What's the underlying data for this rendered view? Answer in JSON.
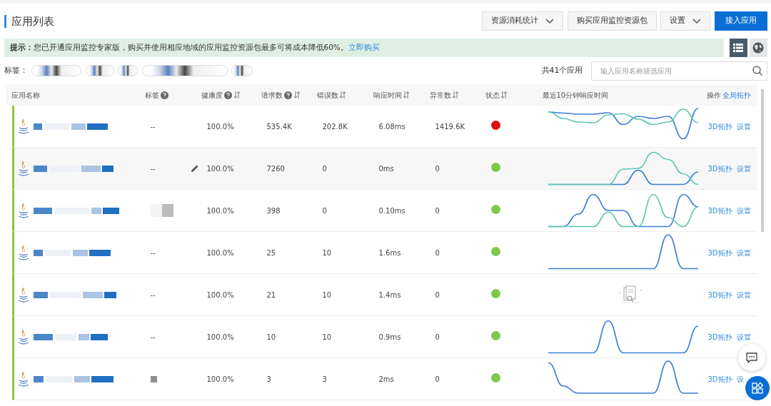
{
  "page": {
    "title": "应用列表"
  },
  "toolbar": [
    {
      "label": "资源消耗统计",
      "kind": "dropdown"
    },
    {
      "label": "购买应用监控资源包",
      "kind": "button"
    },
    {
      "label": "设置",
      "kind": "dropdown"
    },
    {
      "label": "接入应用",
      "kind": "primary"
    }
  ],
  "notice": {
    "prefix": "提示：",
    "text": "您已开通应用监控专家版，购买并使用相应地域的应用监控资源包最多可将成本降低60%。",
    "link": "立即购买"
  },
  "view_toggle": [
    {
      "kind": "list",
      "selected": true
    },
    {
      "kind": "globe",
      "selected": false
    }
  ],
  "filter": {
    "label": "标签：",
    "count": "共41个应用",
    "search_placeholder": "输入应用名称筛选应用"
  },
  "table": {
    "columns": [
      {
        "label": "应用名称",
        "help": false,
        "sortable": false
      },
      {
        "label": "标签",
        "help": true,
        "sortable": false
      },
      {
        "label": "健康度",
        "help": true,
        "sortable": true
      },
      {
        "label": "请求数",
        "help": true,
        "sortable": true
      },
      {
        "label": "错误数",
        "help": false,
        "sortable": true
      },
      {
        "label": "响应时间",
        "help": false,
        "sortable": true
      },
      {
        "label": "异常数",
        "help": false,
        "sortable": true
      },
      {
        "label": "状态",
        "help": false,
        "sortable": true
      },
      {
        "label": "最近10分钟响应时间",
        "help": false,
        "sortable": false
      },
      {
        "label": "操作",
        "help": false,
        "sortable": false,
        "link": "全局拓扑"
      }
    ],
    "rows": [
      {
        "tag": {
          "kind": "text",
          "text": "--"
        },
        "health": "100.0%",
        "requests": "535.4K",
        "errors": "202.8K",
        "response": "6.08ms",
        "exceptions": "1419.6K",
        "color": "#e01010",
        "no_data": false,
        "hovered": false,
        "actions": [
          "3D拓扑",
          "设置"
        ]
      },
      {
        "tag": {
          "kind": "text",
          "text": "--"
        },
        "health": "100.0%",
        "requests": "7260",
        "errors": "0",
        "response": "0ms",
        "exceptions": "0",
        "color": "#7ec94a",
        "no_data": false,
        "hovered": true,
        "actions": [
          "3D拓扑",
          "设置"
        ]
      },
      {
        "tag": {
          "kind": "hidden"
        },
        "health": "100.0%",
        "requests": "398",
        "errors": "0",
        "response": "0.10ms",
        "exceptions": "0",
        "color": "#7ec94a",
        "no_data": false,
        "hovered": false,
        "actions": [
          "3D拓扑",
          "设置"
        ]
      },
      {
        "tag": {
          "kind": "text",
          "text": "--"
        },
        "health": "100.0%",
        "requests": "25",
        "errors": "10",
        "response": "1.6ms",
        "exceptions": "0",
        "color": "#7ec94a",
        "no_data": false,
        "hovered": false,
        "actions": [
          "3D拓扑",
          "设置"
        ]
      },
      {
        "tag": {
          "kind": "text",
          "text": "--"
        },
        "health": "100.0%",
        "requests": "21",
        "errors": "10",
        "response": "1.4ms",
        "exceptions": "0",
        "color": "#7ec94a",
        "no_data": true,
        "hovered": false,
        "actions": [
          "3D拓扑",
          "设置"
        ]
      },
      {
        "tag": {
          "kind": "text",
          "text": "--"
        },
        "health": "100.0%",
        "requests": "10",
        "errors": "10",
        "response": "0.9ms",
        "exceptions": "0",
        "color": "#7ec94a",
        "no_data": false,
        "hovered": false,
        "actions": [
          "3D拓扑",
          "设置"
        ]
      },
      {
        "tag": {
          "kind": "square"
        },
        "health": "100.0%",
        "requests": "3",
        "errors": "3",
        "response": "2ms",
        "exceptions": "0",
        "color": "#7ec94a",
        "no_data": false,
        "hovered": false,
        "actions": [
          "3D拓扑",
          "设"
        ]
      }
    ]
  }
}
